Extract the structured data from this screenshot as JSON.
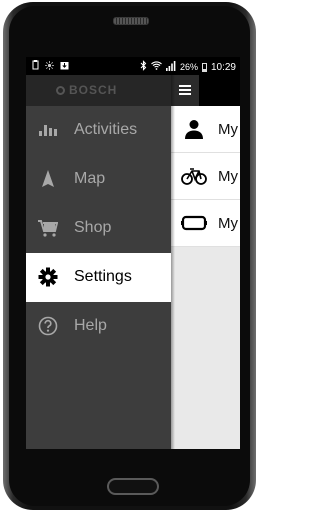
{
  "status_bar": {
    "battery_percent": "26%",
    "time": "10:29",
    "left_icons": [
      "usb-icon",
      "brightness-icon",
      "download-icon"
    ],
    "right_icons": [
      "bluetooth-icon",
      "wifi-icon",
      "signal-icon",
      "battery-icon"
    ]
  },
  "drawer": {
    "brand": "BOSCH",
    "items": [
      {
        "label": "Activities",
        "icon": "bar-chart-icon",
        "active": false
      },
      {
        "label": "Map",
        "icon": "navigation-arrow-icon",
        "active": false
      },
      {
        "label": "Shop",
        "icon": "cart-icon",
        "active": false
      },
      {
        "label": "Settings",
        "icon": "gear-icon",
        "active": true
      },
      {
        "label": "Help",
        "icon": "help-icon",
        "active": false
      }
    ]
  },
  "settings_list": {
    "items": [
      {
        "label": "My",
        "icon": "person-icon"
      },
      {
        "label": "My",
        "icon": "bicycle-icon"
      },
      {
        "label": "My",
        "icon": "display-device-icon"
      }
    ]
  },
  "colors": {
    "drawer_bg": "#3d3d3d",
    "drawer_header_bg": "#262626",
    "active_item_bg": "#ffffff",
    "inactive_text": "#a8a8a8"
  }
}
